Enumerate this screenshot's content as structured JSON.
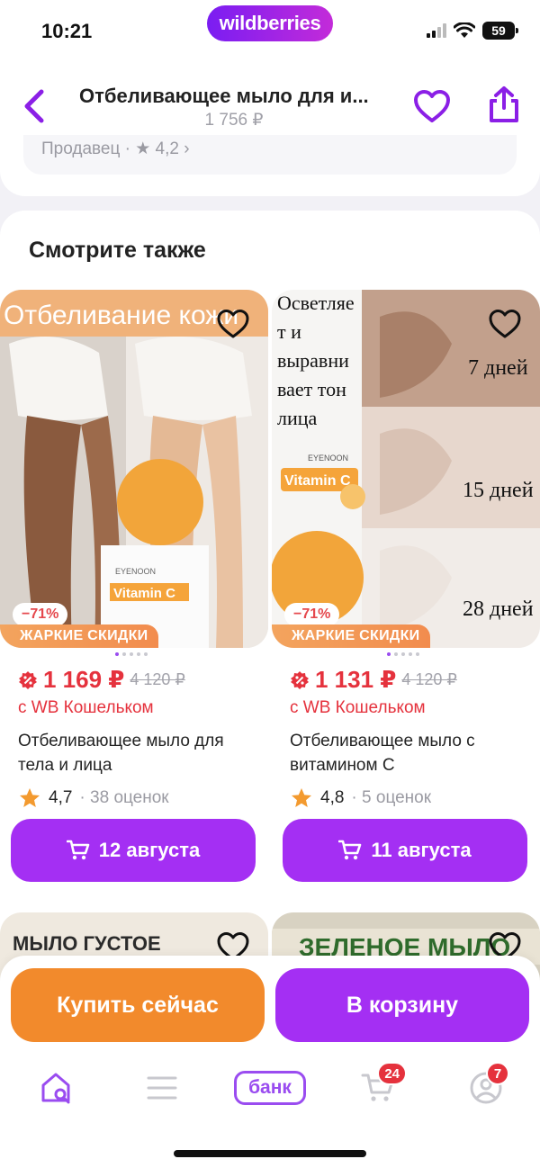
{
  "status": {
    "time": "10:21",
    "battery": "59"
  },
  "brand": {
    "logo": "wildberries"
  },
  "header": {
    "title": "Отбеливающее мыло для и...",
    "price": "1 756 ₽",
    "back_icon": "chevron-left-icon",
    "favorite_icon": "heart-outline-icon",
    "share_icon": "share-icon"
  },
  "seller": {
    "text": "Продавец · ★ 4,2 ›"
  },
  "see_also": {
    "title": "Смотрите также",
    "products": [
      {
        "image_text": "Отбеливание кожи",
        "image_brand": "EYENOON",
        "image_product": "Vitamin C",
        "discount": "−71%",
        "promo": "ЖАРКИЕ СКИДКИ",
        "price": "1 169 ₽",
        "old_price": "4 120 ₽",
        "wallet": "с WB Кошельком",
        "name": "Отбеливающее мыло для тела и лица",
        "rating": "4,7",
        "reviews": "· 38 оценок",
        "delivery": "12 августа"
      },
      {
        "image_text_lines": [
          "Осветляе",
          "т и",
          "выравни",
          "вает тон",
          "лица"
        ],
        "image_days": [
          "7 дней",
          "15 дней",
          "28 дней"
        ],
        "image_brand": "EYENOON",
        "image_product": "Vitamin C",
        "discount": "−71%",
        "promo": "ЖАРКИЕ СКИДКИ",
        "price": "1 131 ₽",
        "old_price": "4 120 ₽",
        "wallet": "с WB Кошельком",
        "name": "Отбеливающее мыло с витамином С",
        "rating": "4,8",
        "reviews": "· 5 оценок",
        "delivery": "11 августа"
      }
    ],
    "next_row": [
      {
        "image_text": "МЫЛО ГУСТОЕ"
      },
      {
        "image_text": "ЗЕЛЕНОЕ МЫЛО"
      }
    ]
  },
  "actions": {
    "buy_now": "Купить сейчас",
    "add_to_cart": "В корзину"
  },
  "tabbar": {
    "bank": "банк",
    "cart_badge": "24",
    "profile_badge": "7"
  },
  "colors": {
    "accent": "#a42ff3",
    "orange": "#f28a2c",
    "price_red": "#e5323d"
  }
}
